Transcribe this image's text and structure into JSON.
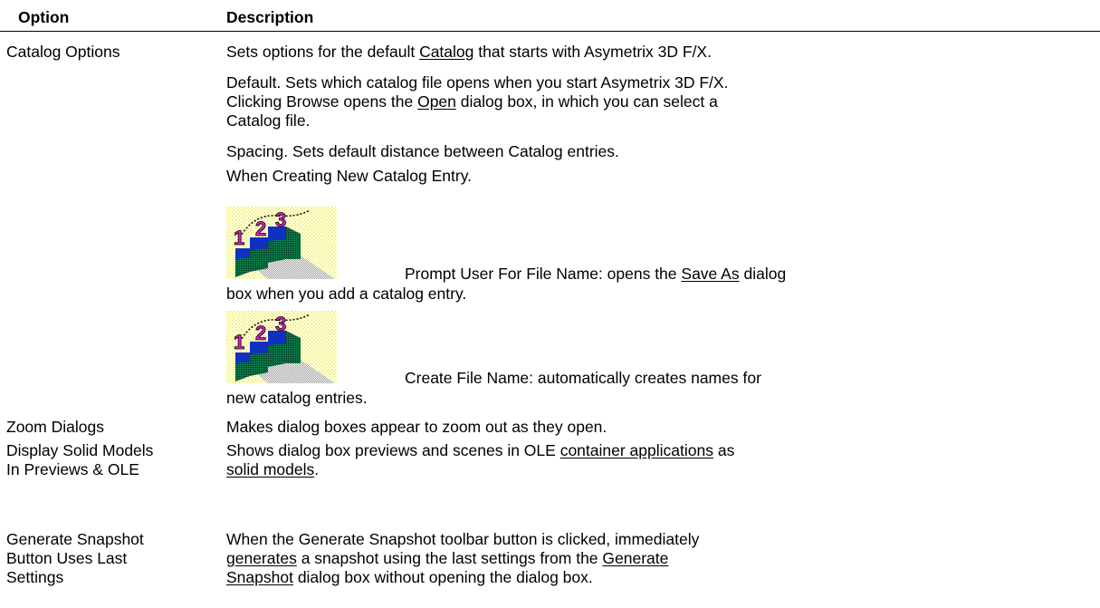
{
  "header": {
    "option": "Option",
    "description": "Description"
  },
  "rows": [
    {
      "option": "Catalog Options"
    },
    {
      "option": "Zoom Dialogs"
    },
    {
      "option": "Display Solid Models In Previews & OLE"
    },
    {
      "option": "Generate Snapshot Button Uses Last Settings"
    }
  ],
  "catalog": {
    "l1_pre": "Sets options for the default ",
    "l1_link": "Catalog",
    "l1_post": " that starts with Asymetrix 3D F/X.",
    "l2": "Default. Sets which catalog file opens when you start Asymetrix 3D F/X.",
    "l3_pre": "Clicking Browse opens the ",
    "l3_link": "Open",
    "l3_post": " dialog box, in which you can select a",
    "l4": "Catalog file.",
    "l5": "Spacing. Sets default distance between Catalog entries.",
    "l6": "When Creating New Catalog Entry.",
    "p1_pre": "Prompt User For File Name: opens the ",
    "p1_link": "Save As",
    "p1_post": " dialog",
    "p1_cont": "box when you add a catalog entry.",
    "p2": "Create File Name: automatically creates names for",
    "p2_cont": "new catalog entries.",
    "icon": "numbered-steps-icon"
  },
  "zoom": {
    "desc": "Makes dialog boxes appear to zoom out as they open."
  },
  "solid": {
    "pre": "Shows dialog box previews and scenes in OLE ",
    "link1": "container applications",
    "post": " as",
    "link2": "solid models",
    "end": "."
  },
  "snapshot": {
    "l1": "When the Generate Snapshot toolbar button is clicked, immediately",
    "link1": "generates",
    "mid": " a snapshot using the last settings from the ",
    "link2": "Generate",
    "link3": "Snapshot",
    "l3_post": " dialog box without opening the dialog box."
  }
}
